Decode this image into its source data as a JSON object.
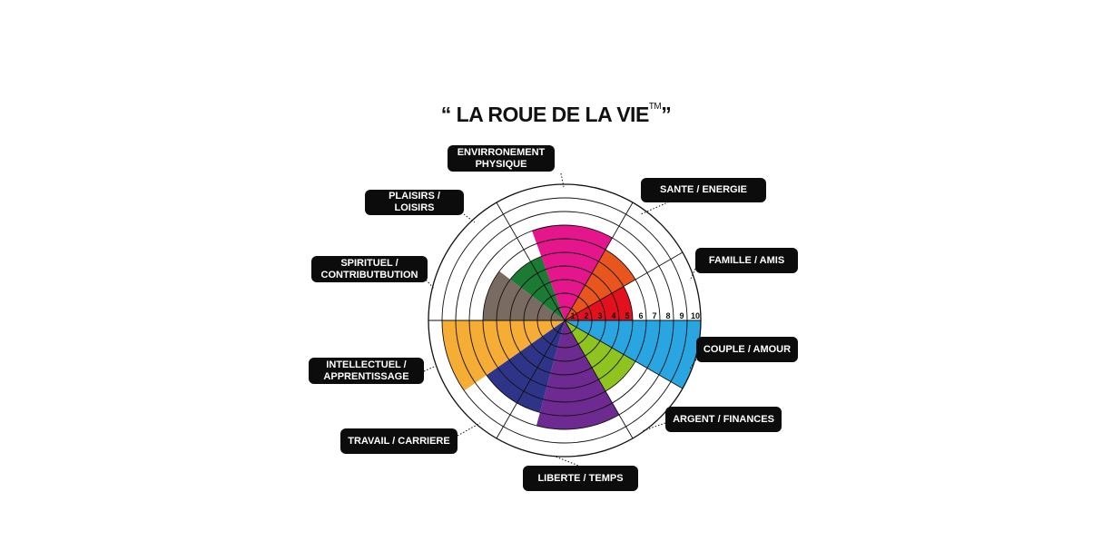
{
  "title": {
    "text": "“ LA ROUE DE LA VIE",
    "trademark": "TM",
    "close_quote": "”"
  },
  "scale_labels": [
    "1",
    "2",
    "3",
    "4",
    "5",
    "6",
    "7",
    "8",
    "9",
    "10"
  ],
  "categories": [
    {
      "key": "environnement",
      "label": "ENVIRRONEMENT\nPHYSIQUE",
      "score": 0,
      "color": ""
    },
    {
      "key": "sante",
      "label": "SANTE / ENERGIE",
      "score": 6,
      "color": "#e8561e"
    },
    {
      "key": "famille",
      "label": "FAMILLE / AMIS",
      "score": 5,
      "color": "#e3101e"
    },
    {
      "key": "couple",
      "label": "COUPLE / AMOUR",
      "score": 10,
      "color": "#29a6e2"
    },
    {
      "key": "argent",
      "label": "ARGENT / FINANCES",
      "score": 6,
      "color": "#8fc31f"
    },
    {
      "key": "liberte",
      "label": "LIBERTE / TEMPS",
      "score": 8,
      "color": "#6d2a90"
    },
    {
      "key": "travail",
      "label": "TRAVAIL / CARRIERE",
      "score": 7,
      "color": "#2e3589"
    },
    {
      "key": "intellectuel",
      "label": "INTELLECTUEL /\nAPPRENTISSAGE",
      "score": 9,
      "color": "#f6ad35"
    },
    {
      "key": "spirituel",
      "label": "SPIRITUEL /\nCONTRIBUTBUTION",
      "score": 6,
      "color": "#7a6b62"
    },
    {
      "key": "plaisirs",
      "label": "PLAISIRS /\nLOISIRS",
      "score": 5,
      "color": "#1b7b35"
    },
    {
      "key": "pink",
      "label": "",
      "score": 7,
      "color": "#e5168c"
    }
  ]
}
